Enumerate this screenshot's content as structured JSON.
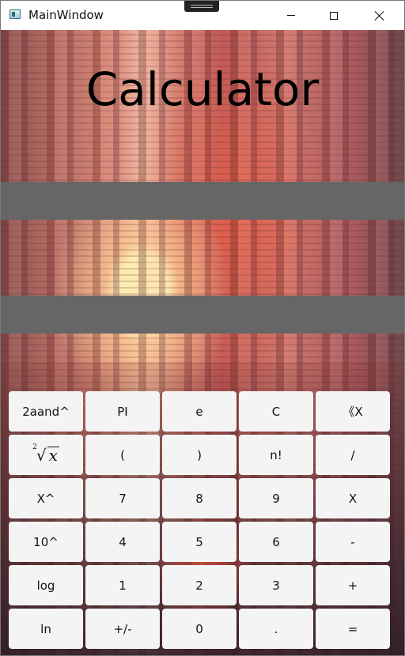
{
  "window": {
    "title": "MainWindow",
    "controls": [
      "minimize",
      "maximize",
      "close"
    ]
  },
  "app": {
    "heading": "Calculator",
    "expression_display": "",
    "result_display": ""
  },
  "keypad": {
    "rows": [
      [
        "2aand^",
        "PI",
        "e",
        "C",
        "《X"
      ],
      [
        "√x",
        "(",
        ")",
        "n!",
        "/"
      ],
      [
        "X^",
        "7",
        "8",
        "9",
        "X"
      ],
      [
        "10^",
        "4",
        "5",
        "6",
        "-"
      ],
      [
        "log",
        "1",
        "2",
        "3",
        "+"
      ],
      [
        "ln",
        "+/-",
        "0",
        ".",
        "="
      ]
    ],
    "sqrt_label": {
      "index": "2",
      "radicand": "x"
    }
  },
  "colors": {
    "display_band": "#666666",
    "button_background": "#f4f4f4",
    "heading_text": "#000000"
  },
  "icons": {
    "app": "window-app-icon",
    "minimize": "minimize-icon",
    "maximize": "maximize-icon",
    "close": "close-icon"
  }
}
